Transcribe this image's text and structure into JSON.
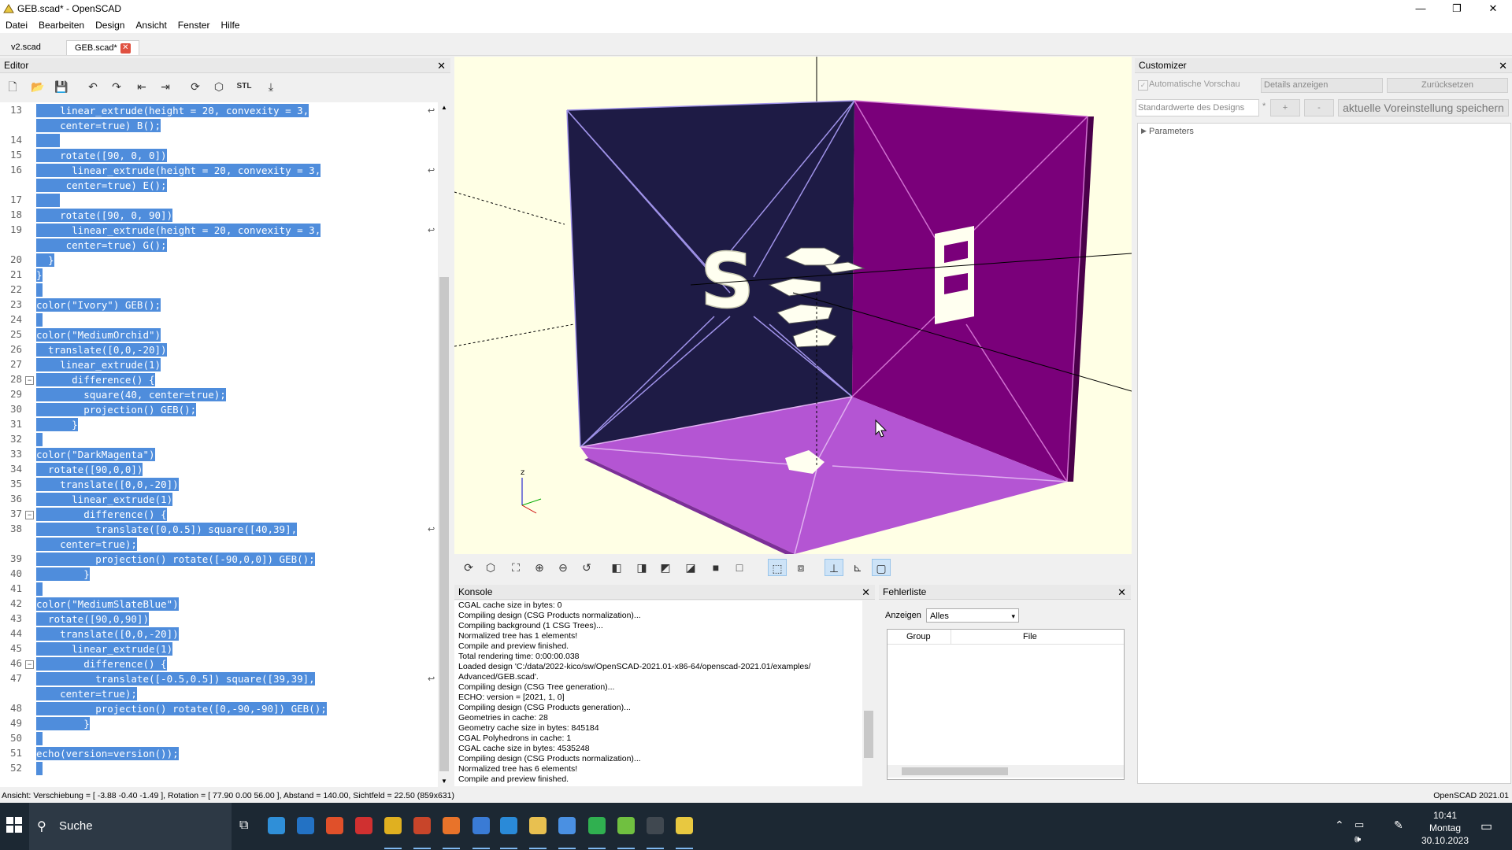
{
  "window": {
    "title": "GEB.scad* - OpenSCAD",
    "minimize": "—",
    "maximize": "❐",
    "close": "✕"
  },
  "menu": [
    "Datei",
    "Bearbeiten",
    "Design",
    "Ansicht",
    "Fenster",
    "Hilfe"
  ],
  "file_tabs": [
    {
      "label": "v2.scad",
      "active": false
    },
    {
      "label": "GEB.scad*",
      "active": true
    }
  ],
  "editor": {
    "title": "Editor",
    "toolbar": [
      "new-file-icon",
      "open-folder-icon",
      "save-icon",
      "undo-icon",
      "redo-icon",
      "unindent-icon",
      "indent-icon",
      "preview-icon",
      "render-icon",
      "export-stl-icon",
      "send-to-printer-icon"
    ],
    "stl_label": "STL",
    "lines": [
      {
        "n": "13",
        "text": "    linear_extrude(height = 20, convexity = 3,",
        "wrap": true
      },
      {
        "n": "",
        "text": "    center=true) B();",
        "wrap": false
      },
      {
        "n": "14",
        "text": "    ",
        "wrap": false
      },
      {
        "n": "15",
        "text": "    rotate([90, 0, 0])",
        "wrap": false
      },
      {
        "n": "16",
        "text": "      linear_extrude(height = 20, convexity = 3,",
        "wrap": true
      },
      {
        "n": "",
        "text": "     center=true) E();",
        "wrap": false
      },
      {
        "n": "17",
        "text": "    ",
        "wrap": false
      },
      {
        "n": "18",
        "text": "    rotate([90, 0, 90])",
        "wrap": false
      },
      {
        "n": "19",
        "text": "      linear_extrude(height = 20, convexity = 3,",
        "wrap": true
      },
      {
        "n": "",
        "text": "     center=true) G();",
        "wrap": false
      },
      {
        "n": "20",
        "text": "  }",
        "wrap": false
      },
      {
        "n": "21",
        "text": "}",
        "wrap": false
      },
      {
        "n": "22",
        "text": "",
        "wrap": false
      },
      {
        "n": "23",
        "text": "color(\"Ivory\") GEB();",
        "wrap": false
      },
      {
        "n": "24",
        "text": "",
        "wrap": false
      },
      {
        "n": "25",
        "text": "color(\"MediumOrchid\")",
        "wrap": false
      },
      {
        "n": "26",
        "text": "  translate([0,0,-20])",
        "wrap": false
      },
      {
        "n": "27",
        "text": "    linear_extrude(1)",
        "wrap": false
      },
      {
        "n": "28",
        "text": "      difference() {",
        "wrap": false,
        "fold": true
      },
      {
        "n": "29",
        "text": "        square(40, center=true);",
        "wrap": false
      },
      {
        "n": "30",
        "text": "        projection() GEB();",
        "wrap": false
      },
      {
        "n": "31",
        "text": "      }",
        "wrap": false
      },
      {
        "n": "32",
        "text": "",
        "wrap": false
      },
      {
        "n": "33",
        "text": "color(\"DarkMagenta\")",
        "wrap": false
      },
      {
        "n": "34",
        "text": "  rotate([90,0,0])",
        "wrap": false
      },
      {
        "n": "35",
        "text": "    translate([0,0,-20])",
        "wrap": false
      },
      {
        "n": "36",
        "text": "      linear_extrude(1)",
        "wrap": false
      },
      {
        "n": "37",
        "text": "        difference() {",
        "wrap": false,
        "fold": true
      },
      {
        "n": "38",
        "text": "          translate([0,0.5]) square([40,39],",
        "wrap": true
      },
      {
        "n": "",
        "text": "    center=true);",
        "wrap": false
      },
      {
        "n": "39",
        "text": "          projection() rotate([-90,0,0]) GEB();",
        "wrap": false
      },
      {
        "n": "40",
        "text": "        }",
        "wrap": false
      },
      {
        "n": "41",
        "text": "",
        "wrap": false
      },
      {
        "n": "42",
        "text": "color(\"MediumSlateBlue\")",
        "wrap": false
      },
      {
        "n": "43",
        "text": "  rotate([90,0,90])",
        "wrap": false
      },
      {
        "n": "44",
        "text": "    translate([0,0,-20])",
        "wrap": false
      },
      {
        "n": "45",
        "text": "      linear_extrude(1)",
        "wrap": false
      },
      {
        "n": "46",
        "text": "        difference() {",
        "wrap": false,
        "fold": true
      },
      {
        "n": "47",
        "text": "          translate([-0.5,0.5]) square([39,39],",
        "wrap": true
      },
      {
        "n": "",
        "text": "    center=true);",
        "wrap": false
      },
      {
        "n": "48",
        "text": "          projection() rotate([0,-90,-90]) GEB();",
        "wrap": false
      },
      {
        "n": "49",
        "text": "        }",
        "wrap": false
      },
      {
        "n": "50",
        "text": "",
        "wrap": false
      },
      {
        "n": "51",
        "text": "echo(version=version());",
        "wrap": false
      },
      {
        "n": "52",
        "text": "",
        "wrap": false
      }
    ]
  },
  "viewport": {
    "axis_label": "z",
    "colors": {
      "ivory": "#fffff0",
      "medium_orchid": "#b455d3",
      "dark_magenta": "#8b008b",
      "medium_slate_blue": "#7b68ee",
      "background": "#ffffe5"
    }
  },
  "view_toolbar": [
    "preview-icon",
    "render-icon",
    "view-all-icon",
    "zoom-in-icon",
    "zoom-out-icon",
    "reset-view-icon",
    "view-right-icon",
    "view-top-icon",
    "view-bottom-icon",
    "view-left-icon",
    "view-front-icon",
    "view-back-icon",
    "perspective-icon",
    "orthogonal-icon",
    "show-axes-icon",
    "show-scale-icon",
    "show-edges-icon"
  ],
  "console": {
    "title": "Konsole",
    "lines": [
      "CGAL cache size in bytes: 0",
      "Compiling design (CSG Products normalization)...",
      "Compiling background (1 CSG Trees)...",
      "Normalized tree has 1 elements!",
      "Compile and preview finished.",
      "Total rendering time: 0:00:00.038",
      "Loaded design 'C:/data/2022-kico/sw/OpenSCAD-2021.01-x86-64/openscad-2021.01/examples/",
      "Advanced/GEB.scad'.",
      "Compiling design (CSG Tree generation)...",
      "ECHO: version = [2021, 1, 0]",
      "Compiling design (CSG Products generation)...",
      "Geometries in cache: 28",
      "Geometry cache size in bytes: 845184",
      "CGAL Polyhedrons in cache: 1",
      "CGAL cache size in bytes: 4535248",
      "Compiling design (CSG Products normalization)...",
      "Normalized tree has 6 elements!",
      "Compile and preview finished."
    ]
  },
  "errors": {
    "title": "Fehlerliste",
    "show_label": "Anzeigen",
    "filter_value": "Alles",
    "columns": [
      "Group",
      "File"
    ]
  },
  "customizer": {
    "title": "Customizer",
    "auto_preview_label": "Automatische Vorschau",
    "details_value": "Details anzeigen",
    "reset_label": "Zurücksetzen",
    "preset_value": "Standardwerte des Designs",
    "asterisk": "*",
    "plus": "+",
    "minus": "-",
    "save_preset_label": "aktuelle Voreinstellung speichern",
    "parameters_label": "Parameters"
  },
  "statusbar": {
    "view_info": "Ansicht: Verschiebung = [ -3.88 -0.40 -1.49 ], Rotation = [ 77.90 0.00 56.00 ], Abstand = 140.00, Sichtfeld = 22.50 (859x631)",
    "version": "OpenSCAD 2021.01"
  },
  "taskbar": {
    "search_label": "Suche",
    "time": "10:41",
    "day": "Montag",
    "date": "30.10.2023",
    "apps": [
      {
        "name": "edge-icon",
        "color": "#2f8fd8"
      },
      {
        "name": "outlook-icon",
        "color": "#2372c4"
      },
      {
        "name": "brave-icon",
        "color": "#e0502a"
      },
      {
        "name": "xmind-icon",
        "color": "#d03030"
      },
      {
        "name": "chrome-icon",
        "color": "#e0b020"
      },
      {
        "name": "powerpoint-icon",
        "color": "#c8452a"
      },
      {
        "name": "firefox-icon",
        "color": "#e8732a"
      },
      {
        "name": "mail-icon",
        "color": "#3a7bd5"
      },
      {
        "name": "vscode-icon",
        "color": "#2a8ad8"
      },
      {
        "name": "explorer-icon",
        "color": "#e8c050"
      },
      {
        "name": "chromium-icon",
        "color": "#4a90e2"
      },
      {
        "name": "whatsapp-icon",
        "color": "#30b050"
      },
      {
        "name": "notepad-icon",
        "color": "#70c040"
      },
      {
        "name": "terminal-icon",
        "color": "#404850"
      },
      {
        "name": "openscad-icon",
        "color": "#e8c840"
      }
    ]
  }
}
